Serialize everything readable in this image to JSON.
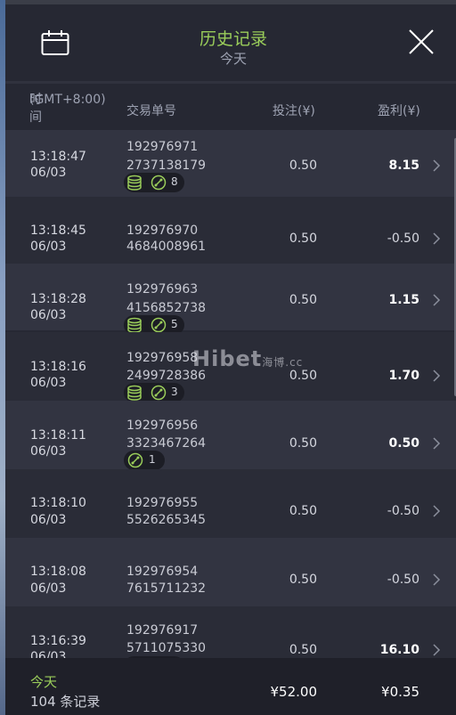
{
  "header": {
    "title": "历史记录",
    "subtitle": "今天"
  },
  "columns": {
    "time": "时间",
    "timezone": "(GMT+8:00)",
    "order": "交易单号",
    "stake": "投注(¥)",
    "profit": "盈利(¥)"
  },
  "rows": [
    {
      "time": "13:18:47",
      "date": "06/03",
      "order1": "192976971",
      "order2": "2737138179",
      "stake": "0.50",
      "profit": "8.15",
      "coin_badge": true,
      "link_count": "8"
    },
    {
      "time": "13:18:45",
      "date": "06/03",
      "order1": "192976970",
      "order2": "4684008961",
      "stake": "0.50",
      "profit": "-0.50",
      "coin_badge": false,
      "link_count": ""
    },
    {
      "time": "13:18:28",
      "date": "06/03",
      "order1": "192976963",
      "order2": "4156852738",
      "stake": "0.50",
      "profit": "1.15",
      "coin_badge": true,
      "link_count": "5"
    },
    {
      "time": "13:18:16",
      "date": "06/03",
      "order1": "192976958",
      "order2": "2499728386",
      "stake": "0.50",
      "profit": "1.70",
      "coin_badge": true,
      "link_count": "3"
    },
    {
      "time": "13:18:11",
      "date": "06/03",
      "order1": "192976956",
      "order2": "3323467264",
      "stake": "0.50",
      "profit": "0.50",
      "coin_badge": false,
      "link_count": "1"
    },
    {
      "time": "13:18:10",
      "date": "06/03",
      "order1": "192976955",
      "order2": "5526265345",
      "stake": "0.50",
      "profit": "-0.50",
      "coin_badge": false,
      "link_count": ""
    },
    {
      "time": "13:18:08",
      "date": "06/03",
      "order1": "192976954",
      "order2": "7615711232",
      "stake": "0.50",
      "profit": "-0.50",
      "coin_badge": false,
      "link_count": ""
    },
    {
      "time": "13:16:39",
      "date": "06/03",
      "order1": "192976917",
      "order2": "5711075330",
      "stake": "0.50",
      "profit": "16.10",
      "coin_badge": true,
      "link_count": ""
    }
  ],
  "watermark": {
    "text": "Hibet",
    "suffix": "海博.cc"
  },
  "footer": {
    "label": "今天",
    "count": "104 条记录",
    "total_stake": "¥52.00",
    "total_profit": "¥0.35"
  },
  "colors": {
    "accent_green": "#9acd5a",
    "bg": "#262833",
    "row_light": "#323441",
    "row_dark": "#2a2c37"
  }
}
